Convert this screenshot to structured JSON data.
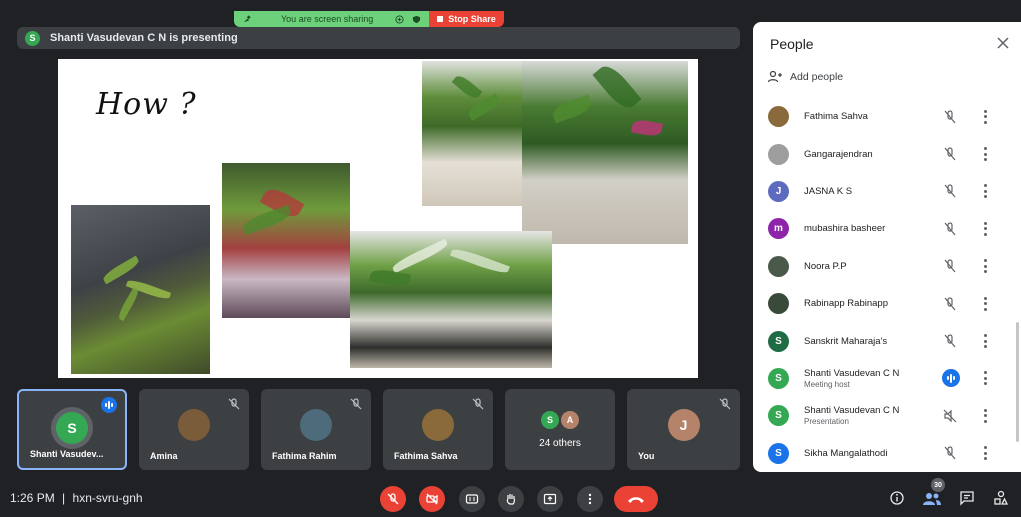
{
  "share_banner": {
    "sharing_text": "You are screen sharing",
    "stop_label": "Stop Share"
  },
  "presenter": {
    "initial": "S",
    "text": "Shanti Vasudevan C N is presenting"
  },
  "slide": {
    "title": "How ?"
  },
  "tiles": [
    {
      "name": "Shanti Vasudev...",
      "initial": "S",
      "color": "#34a853",
      "speaking": true
    },
    {
      "name": "Amina",
      "initial": "",
      "color": "#7a5c3a",
      "muted": true
    },
    {
      "name": "Fathima Rahim",
      "initial": "",
      "color": "#4d6b7a",
      "muted": true
    },
    {
      "name": "Fathima Sahva",
      "initial": "",
      "color": "#8a6a3a",
      "muted": true
    },
    {
      "name": "24 others",
      "initials": [
        "S",
        "A"
      ],
      "others": true
    },
    {
      "name": "You",
      "initial": "J",
      "color": "#b5836a",
      "muted": true
    }
  ],
  "bottom": {
    "time": "1:26 PM",
    "separator": "|",
    "meeting_code": "hxn-svru-gnh",
    "participant_count": "30"
  },
  "panel": {
    "title": "People",
    "add_people": "Add people",
    "people": [
      {
        "name": "Fathima Sahva",
        "initial": "",
        "color": "#8a6a3a"
      },
      {
        "name": "Gangarajendran",
        "initial": "",
        "color": "#9e9e9e"
      },
      {
        "name": "JASNA K S",
        "initial": "J",
        "color": "#5c6bc0"
      },
      {
        "name": "mubashira basheer",
        "initial": "m",
        "color": "#8e24aa"
      },
      {
        "name": "Noora P.P",
        "initial": "",
        "color": "#4a5a4a"
      },
      {
        "name": "Rabinapp Rabinapp",
        "initial": "",
        "color": "#3a4a3a"
      },
      {
        "name": "Sanskrit Maharaja's",
        "initial": "S",
        "color": "#1e6b45"
      },
      {
        "name": "Shanti Vasudevan C N",
        "subtitle": "Meeting host",
        "initial": "S",
        "color": "#34a853",
        "speaking": true
      },
      {
        "name": "Shanti Vasudevan C N",
        "subtitle": "Presentation",
        "initial": "S",
        "color": "#34a853",
        "presentation": true
      },
      {
        "name": "Sikha Mangalathodi",
        "initial": "S",
        "color": "#1a73e8"
      }
    ]
  }
}
